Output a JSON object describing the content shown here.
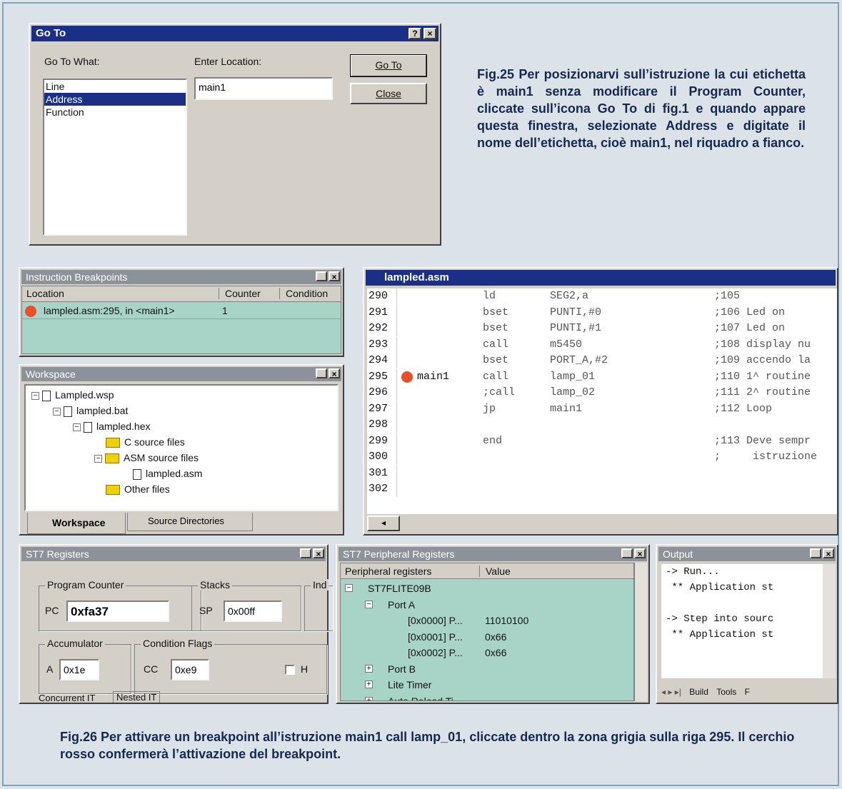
{
  "goto_dialog": {
    "title": "Go To",
    "help_btn": "?",
    "close_btn": "×",
    "go_to_what_label": "Go To What:",
    "enter_location_label": "Enter Location:",
    "list_items": [
      "Line",
      "Address",
      "Function"
    ],
    "selected_item": "Address",
    "location_value": "main1",
    "goto_button": "Go To",
    "close_button": "Close"
  },
  "caption_fig25": "Fig.25 Per posizionarvi sull’istruzione la cui etichetta è main1 senza modificare il Program Counter, cliccate sull’icona Go To di fig.1 e quando appare questa finestra, selezionate Address e digitate il nome dell’etichetta, cioè main1, nel riquadro a fianco.",
  "breakpoints": {
    "title": "Instruction Breakpoints",
    "headers": [
      "Location",
      "Counter",
      "Condition"
    ],
    "rows": [
      {
        "location": "lampled.asm:295, in <main1>",
        "counter": "1",
        "condition": ""
      }
    ]
  },
  "workspace": {
    "title": "Workspace",
    "tree": [
      "Lampled.wsp",
      "lampled.bat",
      "lampled.hex",
      "C source files",
      "ASM source files",
      "lampled.asm",
      "Other files"
    ],
    "tabs": [
      "Workspace",
      "Source Directories"
    ]
  },
  "editor": {
    "title": "lampled.asm",
    "lines": [
      {
        "num": "290",
        "label": "",
        "op": "ld",
        "arg": "SEG2,a",
        "comment": ";105"
      },
      {
        "num": "291",
        "label": "",
        "op": "bset",
        "arg": "PUNTI,#0",
        "comment": ";106 Led on"
      },
      {
        "num": "292",
        "label": "",
        "op": "bset",
        "arg": "PUNTI,#1",
        "comment": ";107 Led on"
      },
      {
        "num": "293",
        "label": "",
        "op": "call",
        "arg": "m5450",
        "comment": ";108 display nu"
      },
      {
        "num": "294",
        "label": "",
        "op": "bset",
        "arg": "PORT_A,#2",
        "comment": ";109 accendo la"
      },
      {
        "num": "295",
        "label": "main1",
        "op": "call",
        "arg": "lamp_01",
        "comment": ";110 1^ routine"
      },
      {
        "num": "296",
        "label": "",
        "op": ";call",
        "arg": "lamp_02",
        "comment": ";111 2^ routine"
      },
      {
        "num": "297",
        "label": "",
        "op": "jp",
        "arg": "main1",
        "comment": ";112 Loop"
      },
      {
        "num": "298",
        "label": "",
        "op": "",
        "arg": "",
        "comment": ""
      },
      {
        "num": "299",
        "label": "",
        "op": "end",
        "arg": "",
        "comment": ";113 Deve sempr"
      },
      {
        "num": "300",
        "label": "",
        "op": "",
        "arg": "",
        "comment": ";     istruzione"
      },
      {
        "num": "301",
        "label": "",
        "op": "",
        "arg": "",
        "comment": ""
      },
      {
        "num": "302",
        "label": "",
        "op": "",
        "arg": "",
        "comment": ""
      }
    ]
  },
  "registers": {
    "title": "ST7 Registers",
    "program_counter_group": "Program Counter",
    "pc_label": "PC",
    "pc_value": "0xfa37",
    "stacks_group": "Stacks",
    "sp_label": "SP",
    "sp_value": "0x00ff",
    "ind_group": "Ind",
    "accumulator_group": "Accumulator",
    "a_label": "A",
    "a_value": "0x1e",
    "cond_group": "Condition Flags",
    "cc_label": "CC",
    "cc_value": "0xe9",
    "h_label": "H",
    "tabs": [
      "Concurrent IT",
      "Nested IT"
    ]
  },
  "peripheral": {
    "title": "ST7 Peripheral Registers",
    "headers": [
      "Peripheral registers",
      "Value"
    ],
    "rows": [
      {
        "name": "ST7FLITE09B",
        "value": "",
        "level": 0,
        "exp": "−"
      },
      {
        "name": "Port A",
        "value": "",
        "level": 1,
        "exp": "−"
      },
      {
        "name": "[0x0000] P...",
        "value": "11010100",
        "level": 2,
        "exp": ""
      },
      {
        "name": "[0x0001] P...",
        "value": "0x66",
        "level": 2,
        "exp": ""
      },
      {
        "name": "[0x0002] P...",
        "value": "0x66",
        "level": 2,
        "exp": ""
      },
      {
        "name": "Port B",
        "value": "",
        "level": 1,
        "exp": "+"
      },
      {
        "name": "Lite Timer",
        "value": "",
        "level": 1,
        "exp": "+"
      },
      {
        "name": "Auto Reload Ti...",
        "value": "",
        "level": 1,
        "exp": "+"
      }
    ]
  },
  "output": {
    "title": "Output",
    "lines": [
      "-> Run...",
      " ** Application st",
      "",
      "-> Step into sourc",
      " ** Application st"
    ],
    "tabs": [
      "Build",
      "Tools",
      "F"
    ]
  },
  "caption_fig26": "Fig.26 Per attivare un breakpoint all’istruzione main1 call lamp_01, cliccate dentro la zona grigia sulla riga 295. Il cerchio rosso confermerà l’attivazione del breakpoint.",
  "colors": {
    "breakpoint": "#e8502a",
    "selection": "#1c2f87",
    "panel_green": "#a8d4c7"
  }
}
